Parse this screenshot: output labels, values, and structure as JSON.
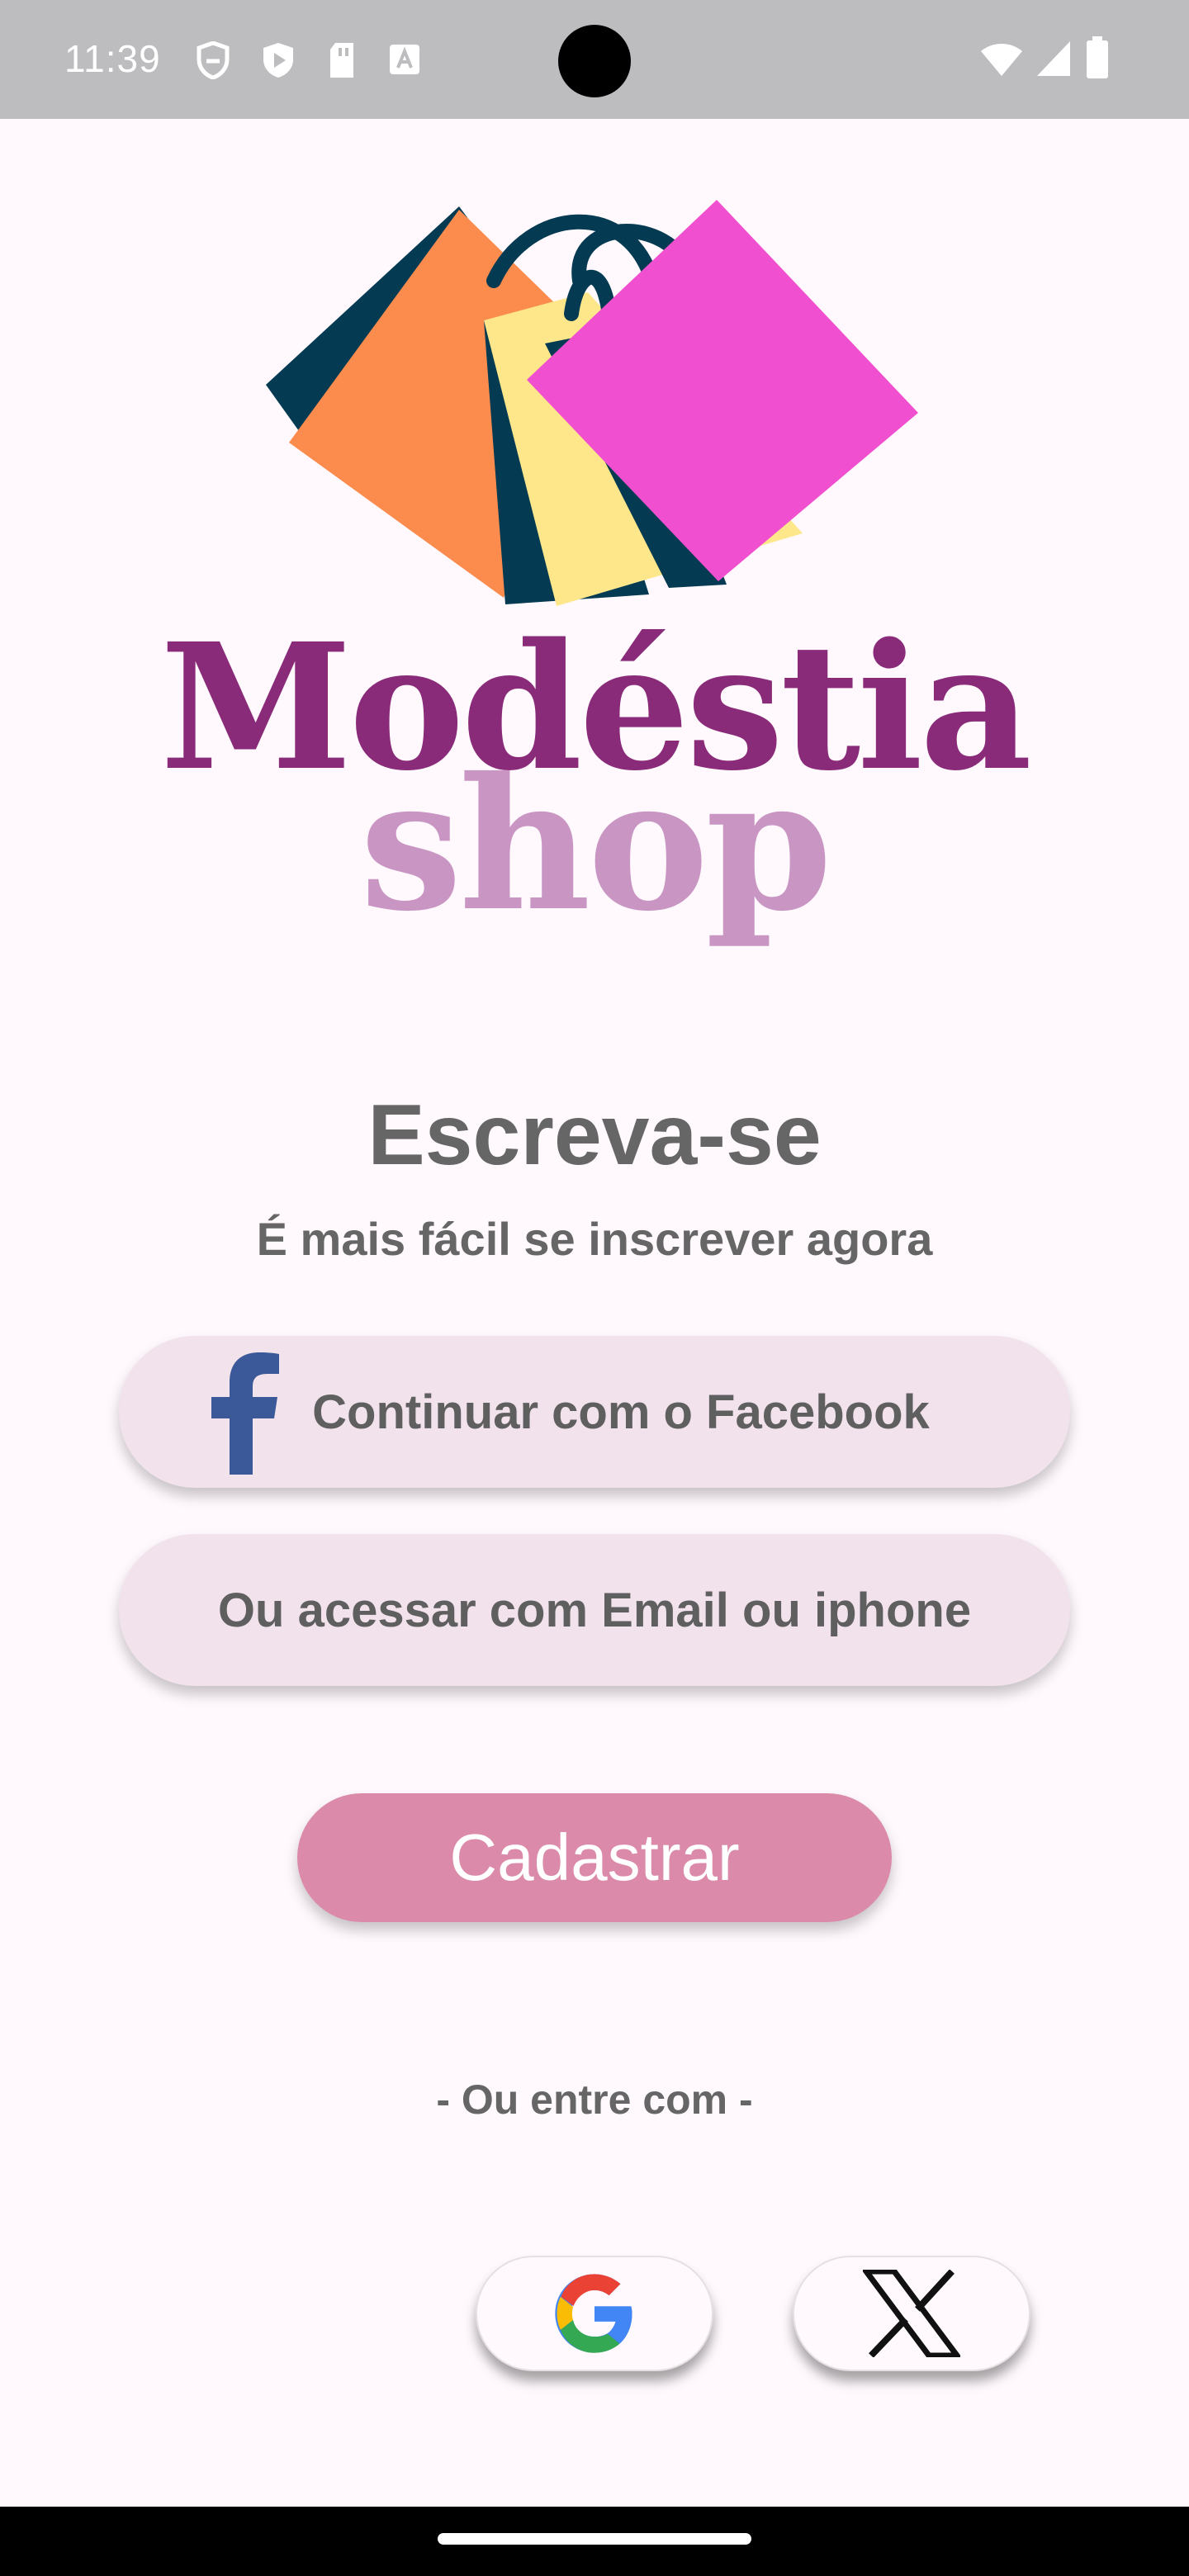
{
  "status_bar": {
    "time": "11:39",
    "left_icons": [
      "shield-icon",
      "play-protect-icon",
      "sd-card-icon",
      "font-a-icon"
    ],
    "right_icons": [
      "wifi-icon",
      "signal-icon",
      "battery-icon"
    ]
  },
  "logo": {
    "brand_line1": "Modéstia",
    "brand_line2": "shop",
    "colors": {
      "orange_bag": "#fb8c4e",
      "dark_teal": "#043a52",
      "yellow_bag": "#fde78a",
      "pink_bag": "#f04fcf",
      "brand_purple": "#8a2b7a",
      "brand_lilac": "#c996c4"
    }
  },
  "signup": {
    "title": "Escreva-se",
    "subtitle": "É mais fácil se inscrever agora",
    "facebook_label": "Continuar com o Facebook",
    "email_label": "Ou acessar com Email ou iphone",
    "cadastrar_label": "Cadastrar",
    "divider": "- Ou entre com -"
  },
  "social": {
    "google_icon": "google-icon",
    "x_icon": "x-icon"
  },
  "colors": {
    "background": "#fff9fd",
    "status_bar": "#bdbcbf",
    "pill_bg": "#f1e2ec",
    "cadastrar_bg": "#dc8aa9",
    "text_gray": "#666666",
    "facebook_blue": "#3b5998"
  }
}
